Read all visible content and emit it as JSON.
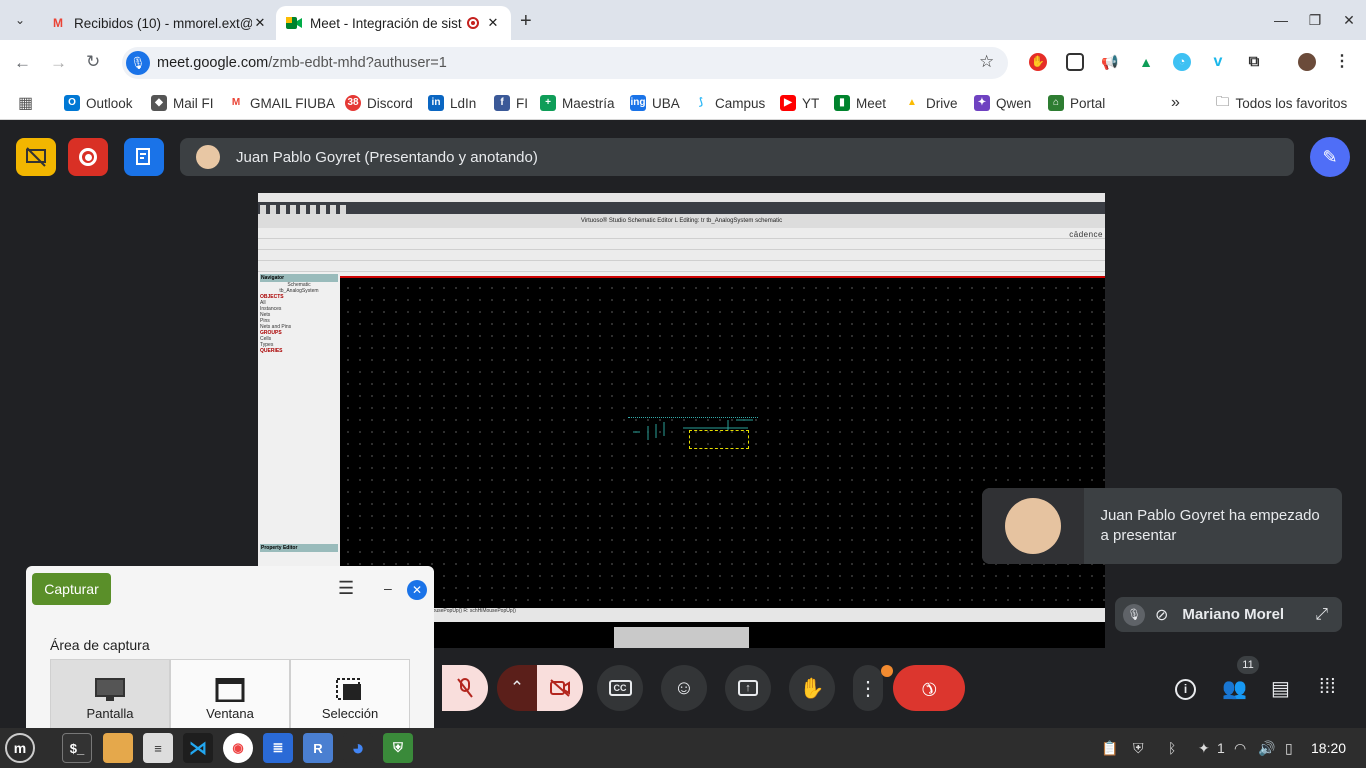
{
  "browser": {
    "tabs": [
      {
        "title": "Recibidos (10) - mmorel.ext@",
        "icon": "gmail-icon"
      },
      {
        "title": "Meet - Integración de sist",
        "icon": "meet-icon"
      }
    ],
    "new_tab": "+",
    "url_host": "meet.google.com",
    "url_path": "/zmb-edbt-mhd?authuser=1",
    "bookmarks": [
      "Outlook",
      "Mail FI",
      "GMAIL FIUBA",
      "Discord",
      "LdIn",
      "FI",
      "Maestría",
      "UBA",
      "Campus",
      "YT",
      "Meet",
      "Drive",
      "Qwen",
      "Portal"
    ],
    "discord_badge": "38",
    "more": "»",
    "all_bookmarks": "Todos los favoritos"
  },
  "meet": {
    "presenter_banner": "Juan Pablo Goyret (Presentando y anotando)",
    "notification": "Juan Pablo Goyret ha empezado a presentar",
    "self_name": "Mariano Morel",
    "participants_count": "11"
  },
  "shared_screen": {
    "window_title": "Virtuoso® Studio Schematic Editor L Editing: tr tb_AnalogSystem schematic",
    "brand": "cādence",
    "navigator_title": "Navigator",
    "nav_items": [
      "Schematic",
      "tb_AnalogSystem",
      "OBJECTS",
      "All",
      "Instances",
      "Nets",
      "Pins",
      "Nets and Pins",
      "GROUPS",
      "Cells",
      "Types",
      "QUERIES"
    ],
    "property_editor": "Property Editor",
    "status_line": "mouse L: schSingleSelectPt()     M: schHiMousePopUp()     R: schHiMousePopUp()"
  },
  "capture_dialog": {
    "button": "Capturar",
    "area_label": "Área de captura",
    "options": [
      "Pantalla",
      "Ventana",
      "Selección"
    ]
  },
  "taskbar": {
    "tray_count": "1",
    "time": "18:20"
  },
  "colors": {
    "meet_bg": "#202124",
    "end_call": "#dc362e",
    "capture_button": "#5a8f29",
    "annotate": "#4f6ef7"
  }
}
